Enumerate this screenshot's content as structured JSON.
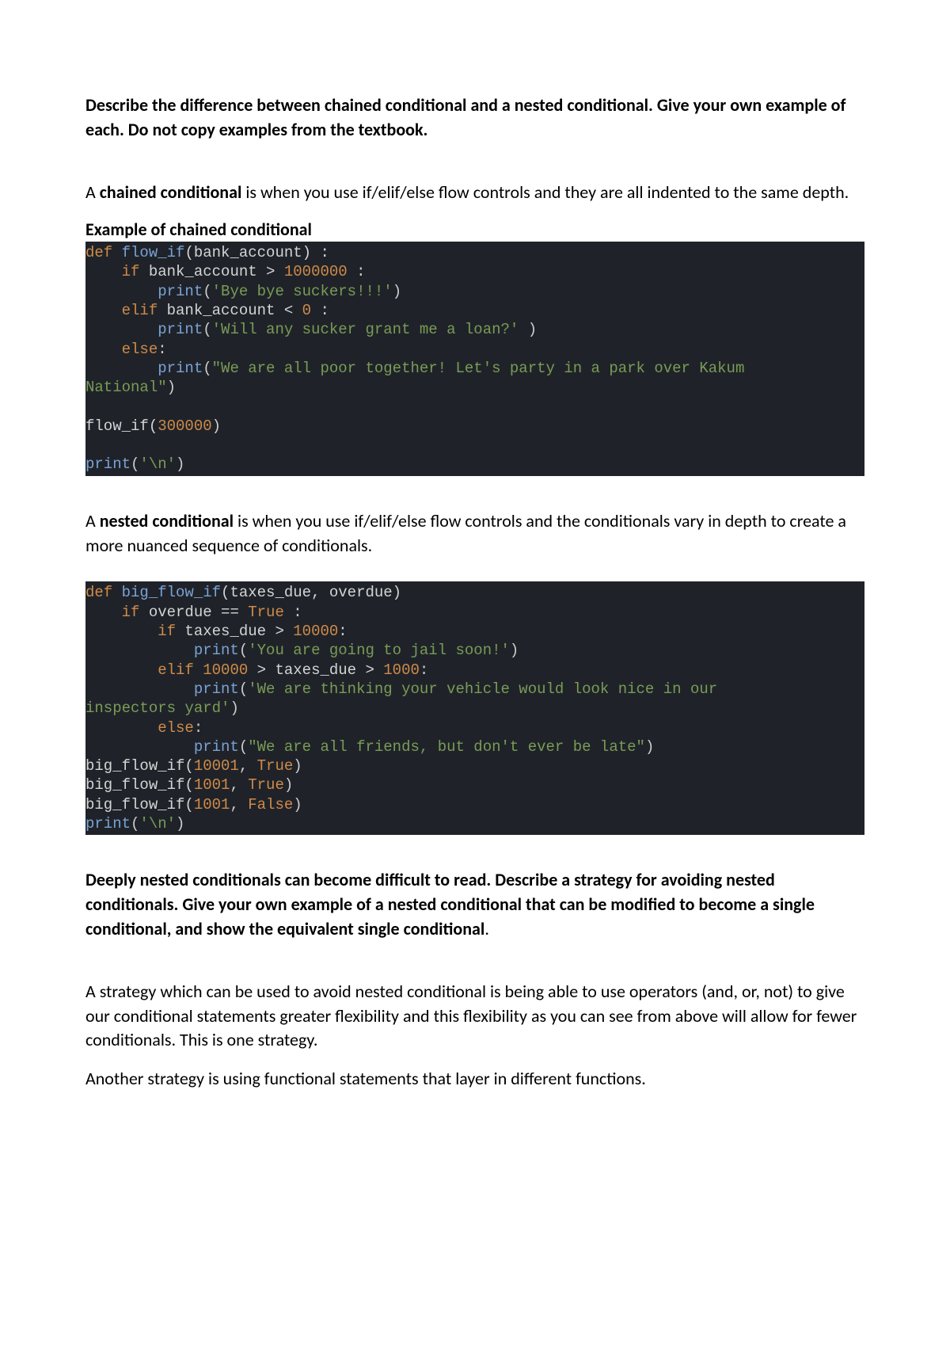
{
  "prompt1": "Describe the difference between chained conditional and a nested conditional.  Give your own example of each. Do not copy examples from the textbook.",
  "chained_para_pre": "A ",
  "chained_para_bold": "chained conditional",
  "chained_para_post": " is when you use if/elif/else flow controls and they are all indented to the same depth.",
  "chained_label": "Example of chained conditional",
  "code1": {
    "l1a": "def",
    "l1b": " flow_if",
    "l1c": "(bank_account) :",
    "l2a": "    if",
    "l2b": " bank_account > ",
    "l2c": "1000000",
    "l2d": " :",
    "l3a": "        print",
    "l3b": "(",
    "l3c": "'Bye bye suckers!!!'",
    "l3d": ")",
    "l4a": "    elif",
    "l4b": " bank_account < ",
    "l4c": "0",
    "l4d": " :",
    "l5a": "        print",
    "l5b": "(",
    "l5c": "'Will any sucker grant me a loan?'",
    "l5d": " )",
    "l6a": "    else",
    "l6b": ":",
    "l7a": "        print",
    "l7b": "(",
    "l7c": "\"We are all poor together! Let's party in a park over Kakum ",
    "l7d": "National\"",
    "l7e": ")",
    "l8": "",
    "l9a": "flow_if(",
    "l9b": "300000",
    "l9c": ")",
    "l10": "",
    "l11a": "print",
    "l11b": "(",
    "l11c": "'\\n'",
    "l11d": ")"
  },
  "nested_para_pre": "A ",
  "nested_para_bold": "nested conditional",
  "nested_para_post": " is when you use if/elif/else flow controls and the conditionals vary in depth to create a more nuanced sequence of conditionals.",
  "code2": {
    "l1a": "def",
    "l1b": " big_flow_if",
    "l1c": "(taxes_due, overdue)",
    "l2a": "    if",
    "l2b": " overdue == ",
    "l2c": "True",
    "l2d": " :",
    "l3a": "        if",
    "l3b": " taxes_due > ",
    "l3c": "10000",
    "l3d": ":",
    "l4a": "            print",
    "l4b": "(",
    "l4c": "'You are going to jail soon!'",
    "l4d": ")",
    "l5a": "        elif",
    "l5b": " ",
    "l5c": "10000",
    "l5d": " > taxes_due > ",
    "l5e": "1000",
    "l5f": ":",
    "l6a": "            print",
    "l6b": "(",
    "l6c": "'We are thinking your vehicle would look nice in our ",
    "l6d": "inspectors yard'",
    "l6e": ")",
    "l7a": "        else",
    "l7b": ":",
    "l8a": "            print",
    "l8b": "(",
    "l8c": "\"We are all friends, but don't ever be late\"",
    "l8d": ")",
    "l9a": "big_flow_if(",
    "l9b": "10001",
    "l9c": ", ",
    "l9d": "True",
    "l9e": ")",
    "l10a": "big_flow_if(",
    "l10b": "1001",
    "l10c": ", ",
    "l10d": "True",
    "l10e": ")",
    "l11a": "big_flow_if(",
    "l11b": "1001",
    "l11c": ", ",
    "l11d": "False",
    "l11e": ")",
    "l12a": "print",
    "l12b": "(",
    "l12c": "'\\n'",
    "l12d": ")"
  },
  "prompt2": "Deeply nested conditionals can become difficult to read. Describe a strategy for avoiding nested conditionals. Give your own example of a nested conditional that can be modified to become a single conditional, and show the equivalent single conditional",
  "prompt2_tail": ".",
  "strategy_para1": "A strategy which can be used to avoid nested conditional is being able to use operators (and, or, not) to give our conditional statements greater flexibility and this flexibility as you can see from above will allow for fewer conditionals. This is one strategy.",
  "strategy_para2": "Another strategy is using functional statements that layer in different functions."
}
